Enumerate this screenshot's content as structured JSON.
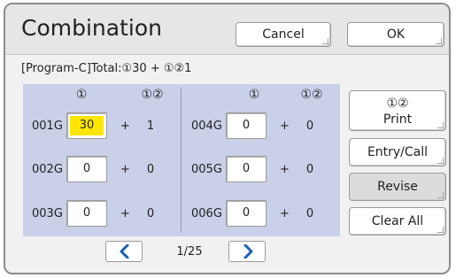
{
  "header": {
    "title": "Combination",
    "cancel_label": "Cancel",
    "ok_label": "OK"
  },
  "summary": "[Program-C]Total:①30 + ①②1",
  "columns": {
    "col1": "①",
    "col12": "①②"
  },
  "programs": [
    {
      "label": "001G",
      "value": "30",
      "plus": "+",
      "count": "1",
      "selected": true
    },
    {
      "label": "002G",
      "value": "0",
      "plus": "+",
      "count": "0"
    },
    {
      "label": "003G",
      "value": "0",
      "plus": "+",
      "count": "0"
    },
    {
      "label": "004G",
      "value": "0",
      "plus": "+",
      "count": "0"
    },
    {
      "label": "005G",
      "value": "0",
      "plus": "+",
      "count": "0"
    },
    {
      "label": "006G",
      "value": "0",
      "plus": "+",
      "count": "0"
    }
  ],
  "side_buttons": {
    "print_line1": "①②",
    "print_line2": "Print",
    "entry_call": "Entry/Call",
    "revise": "Revise",
    "clear_all": "Clear All"
  },
  "pager": {
    "indicator": "1/25",
    "prev_icon": "chevron-left-icon",
    "next_icon": "chevron-right-icon"
  },
  "colors": {
    "accent_arrow": "#1a5fb4",
    "selected_field": "#ffe600",
    "panel_bg": "#c9d0e8"
  }
}
